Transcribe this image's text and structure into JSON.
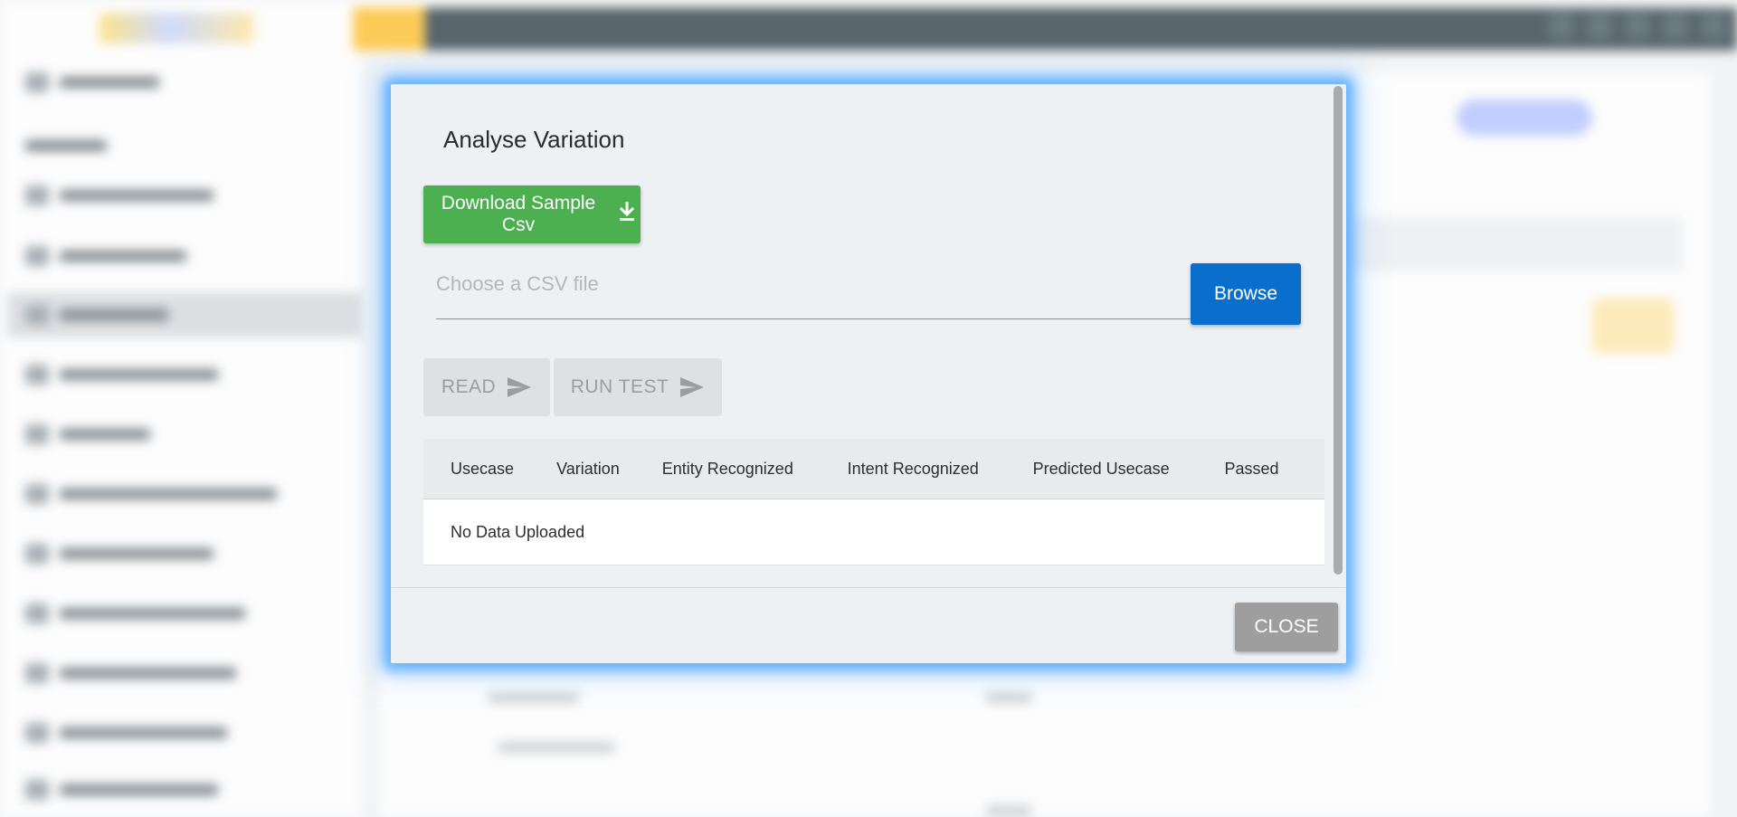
{
  "modal": {
    "title": "Analyse Variation",
    "download_button_label": "Download Sample Csv",
    "file_input_placeholder": "Choose a CSV file",
    "browse_button_label": "Browse",
    "read_button_label": "READ",
    "run_test_button_label": "RUN TEST",
    "close_button_label": "CLOSE",
    "table": {
      "headers": [
        "Usecase",
        "Variation",
        "Entity Recognized",
        "Intent Recognized",
        "Predicted Usecase",
        "Passed"
      ],
      "empty_message": "No Data Uploaded"
    }
  },
  "icons": {
    "download": "download-icon",
    "send": "send-icon"
  },
  "colors": {
    "download_button": "#4caf50",
    "browse_button": "#0a6fcc",
    "close_button": "#9e9e9e",
    "disabled_button": "#dfe0e1",
    "modal_glow": "#56a8ff",
    "modal_background": "#eef1f4"
  }
}
